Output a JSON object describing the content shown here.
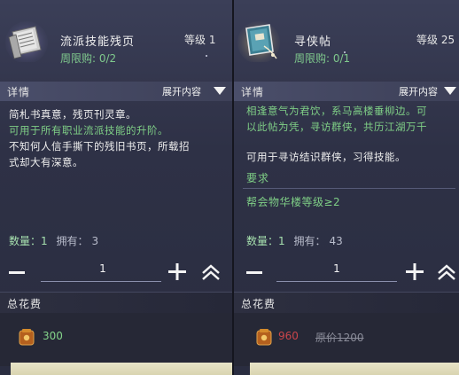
{
  "left": {
    "name": "流派技能残页",
    "level": "等级 1",
    "limit": "周限购: 0/2",
    "detail_title": "详情",
    "expand_label": "展开内容",
    "desc": [
      {
        "text": "简札书真意，残页刊灵章。",
        "tone": "white"
      },
      {
        "text": "可用于所有职业流派技能的升阶。",
        "tone": "green"
      },
      {
        "text": "不知何人信手撕下的残旧书页，所载招",
        "tone": "white"
      },
      {
        "text": "式却大有深意。",
        "tone": "white"
      }
    ],
    "qty_label": "数量：1",
    "own_label": "拥有：",
    "own_value": "3",
    "stepper_value": "1",
    "cost_title": "总花费",
    "price": "300"
  },
  "right": {
    "name": "寻侠帖",
    "level": "等级 25",
    "limit": "周限购: 0/1",
    "detail_title": "详情",
    "expand_label": "展开内容",
    "desc": [
      {
        "text": "相逢意气为君饮，系马高楼垂柳边。可",
        "tone": "green"
      },
      {
        "text": "以此帖为凭，寻访群侠，共历江湖万千",
        "tone": "green"
      },
      {
        "text": "",
        "tone": "white"
      },
      {
        "text": "可用于寻访结识群侠，习得技能。",
        "tone": "white"
      }
    ],
    "req_title": "要求",
    "req_value": "帮会物华楼等级≥2",
    "qty_label": "数量：1",
    "own_label": "拥有：",
    "own_value": "43",
    "stepper_value": "1",
    "cost_title": "总花费",
    "price": "960",
    "old_price": "原价1200"
  },
  "colors": {
    "green_text": "#7fcf86",
    "red_price": "#c9454a",
    "accent_bottom": "#e8e4c8"
  },
  "icons": {
    "item_left": "book-pages-icon",
    "item_right": "scroll-book-icon",
    "minus": "minus-icon",
    "plus": "plus-icon",
    "max": "double-chevron-up-icon",
    "expand": "chevron-down-icon",
    "coin": "coin-pouch-icon"
  }
}
